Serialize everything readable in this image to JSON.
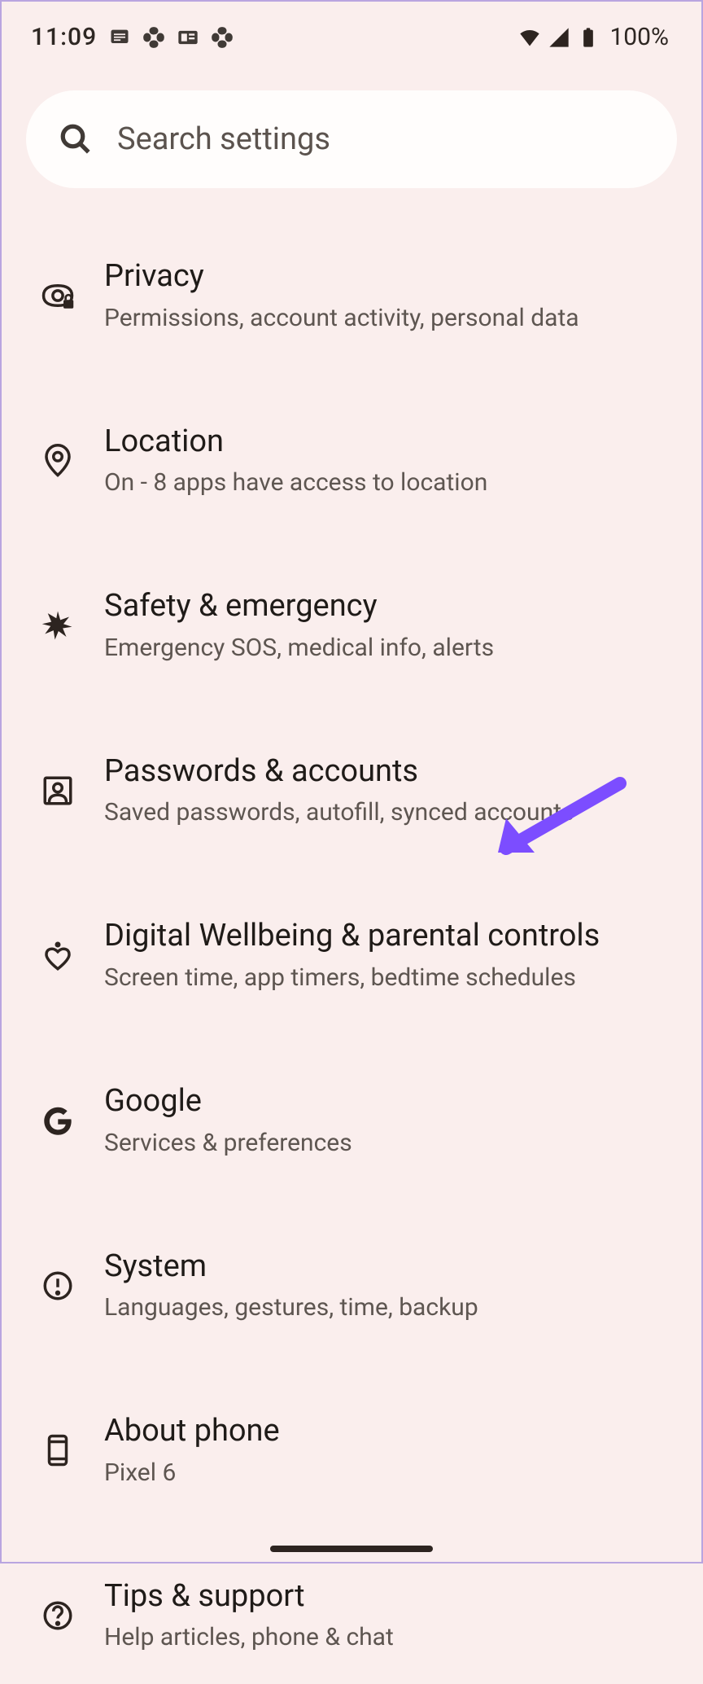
{
  "status": {
    "time": "11:09",
    "battery": "100%"
  },
  "search": {
    "placeholder": "Search settings"
  },
  "items": [
    {
      "title": "Privacy",
      "subtitle": "Permissions, account activity, personal data"
    },
    {
      "title": "Location",
      "subtitle": "On - 8 apps have access to location"
    },
    {
      "title": "Safety & emergency",
      "subtitle": "Emergency SOS, medical info, alerts"
    },
    {
      "title": "Passwords & accounts",
      "subtitle": "Saved passwords, autofill, synced accounts"
    },
    {
      "title": "Digital Wellbeing & parental controls",
      "subtitle": "Screen time, app timers, bedtime schedules"
    },
    {
      "title": "Google",
      "subtitle": "Services & preferences"
    },
    {
      "title": "System",
      "subtitle": "Languages, gestures, time, backup"
    },
    {
      "title": "About phone",
      "subtitle": "Pixel 6"
    },
    {
      "title": "Tips & support",
      "subtitle": "Help articles, phone & chat"
    }
  ]
}
